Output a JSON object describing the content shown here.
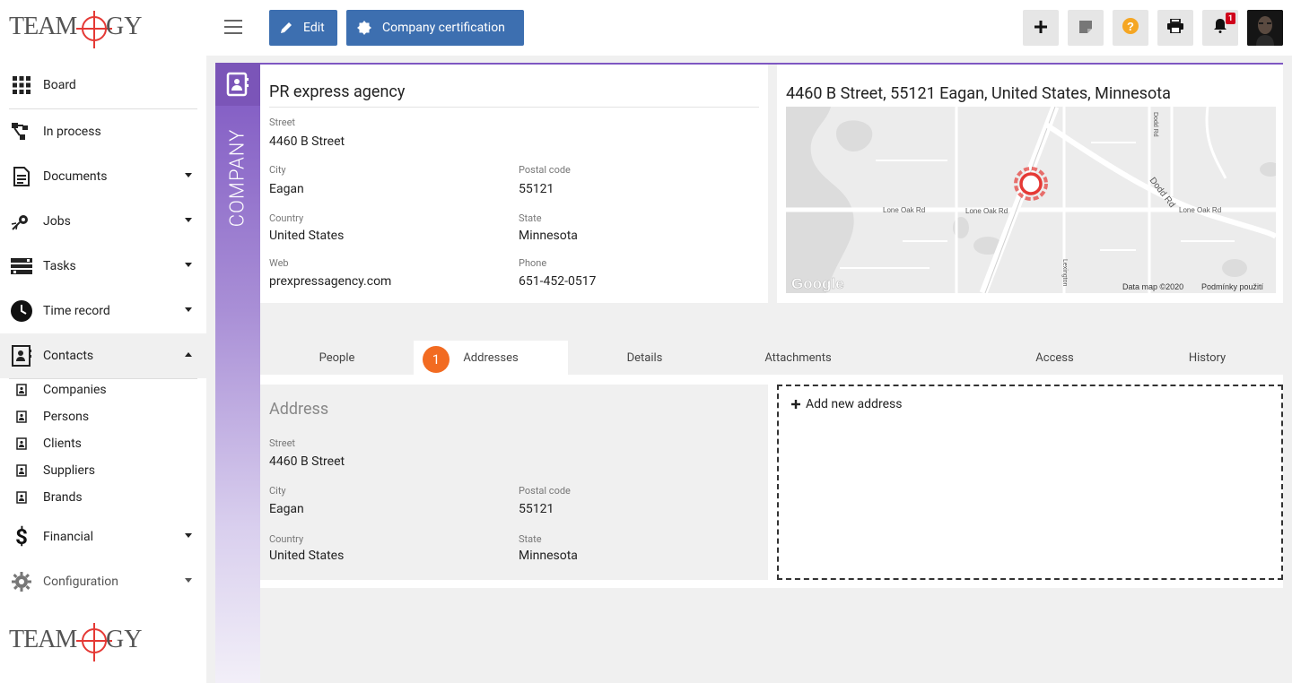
{
  "brand": {
    "name": "TEAMOGY"
  },
  "nav": {
    "board": "Board",
    "in_process": "In process",
    "documents": "Documents",
    "jobs": "Jobs",
    "tasks": "Tasks",
    "time_record": "Time record",
    "contacts": "Contacts",
    "financial": "Financial",
    "configuration": "Configuration",
    "contacts_sub": [
      "Companies",
      "Persons",
      "Clients",
      "Suppliers",
      "Brands"
    ]
  },
  "toolbar": {
    "edit_label": "Edit",
    "cert_label": "Company certification",
    "notification_count": "1"
  },
  "side_label": "COMPANY",
  "company": {
    "name": "PR express agency",
    "street_label": "Street",
    "street": "4460  B Street",
    "city_label": "City",
    "city": "Eagan",
    "postal_label": "Postal code",
    "postal": "55121",
    "country_label": "Country",
    "country": "United States",
    "state_label": "State",
    "state": "Minnesota",
    "web_label": "Web",
    "web": "prexpressagency.com",
    "phone_label": "Phone",
    "phone": "651-452-0517"
  },
  "map": {
    "title": "4460 B Street, 55121 Eagan, United States, Minnesota",
    "road_labels": [
      "Lone Oak Rd",
      "Lone Oak Rd",
      "Lone Oak Rd",
      "Dodd Rd",
      "Dodd Rd",
      "Lexington"
    ],
    "google": "Google",
    "data_credit": "Data map ©2020",
    "terms": "Podmínky použití"
  },
  "tabs": {
    "items": [
      "People",
      "Addresses",
      "Details",
      "Attachments",
      "Access",
      "History"
    ],
    "active": "Addresses",
    "badge": "1"
  },
  "address": {
    "title": "Address",
    "street_label": "Street",
    "street": "4460  B Street",
    "city_label": "City",
    "city": "Eagan",
    "postal_label": "Postal code",
    "postal": "55121",
    "country_label": "Country",
    "country": "United States",
    "state_label": "State",
    "state": "Minnesota"
  },
  "add_address": "Add new address",
  "colors": {
    "primary": "#3d6fb0",
    "purple": "#7e57c2",
    "badge_orange": "#f26b21",
    "notif_red": "#d0021b",
    "help_orange": "#f5a623"
  }
}
